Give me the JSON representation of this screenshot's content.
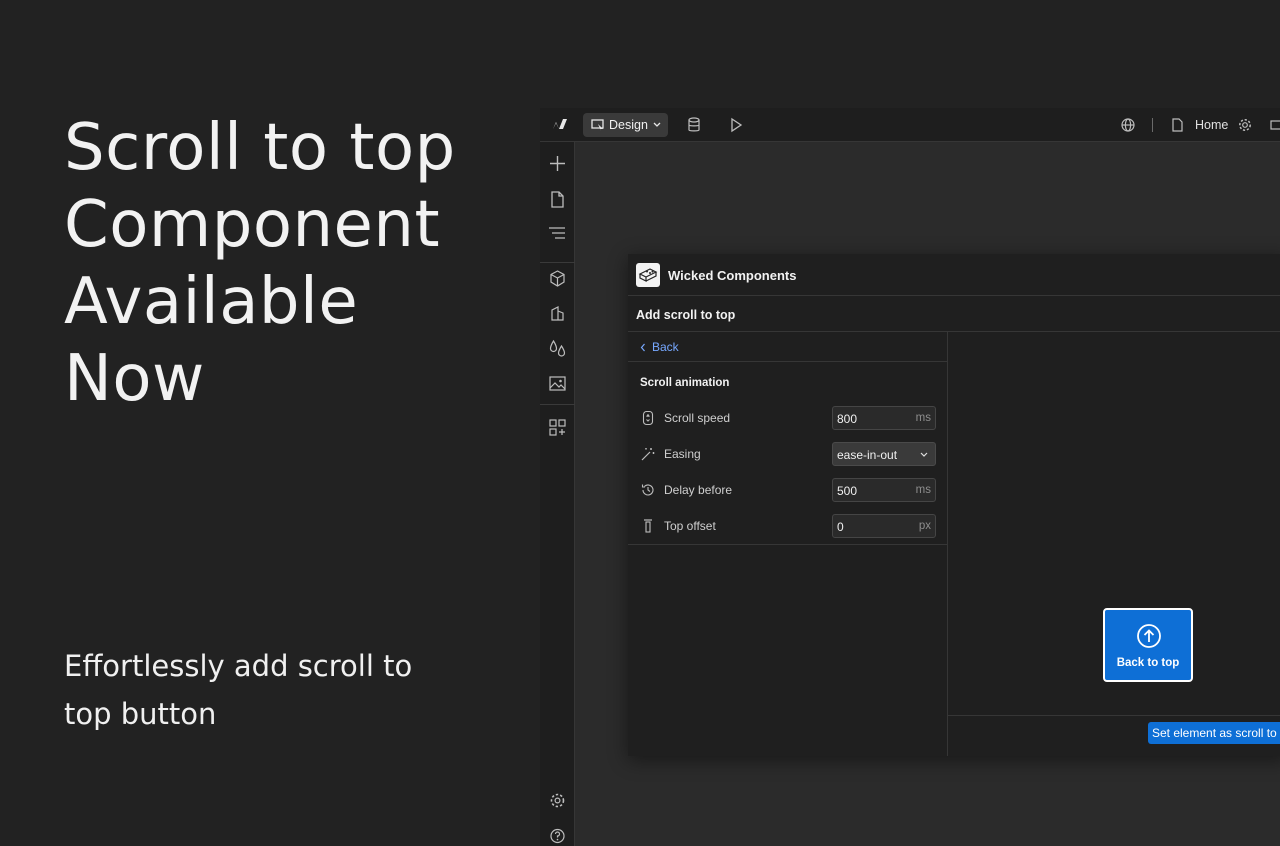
{
  "hero": {
    "lines": [
      "Scroll to top",
      "Component",
      "Available",
      "Now"
    ],
    "subtitle_lines": [
      "Effortlessly add scroll to",
      "top button"
    ]
  },
  "topbar": {
    "mode_label": "Design",
    "page_label": "Home"
  },
  "panel": {
    "app_name": "Wicked Components",
    "title": "Add scroll to top",
    "back_label": "Back",
    "section_title": "Scroll animation",
    "fields": [
      {
        "label": "Scroll speed",
        "value": "800",
        "unit": "ms",
        "icon": "mouse-scroll-icon"
      },
      {
        "label": "Easing",
        "value": "ease-in-out",
        "icon": "magic-wand-icon"
      },
      {
        "label": "Delay before",
        "value": "500",
        "unit": "ms",
        "icon": "history-icon"
      },
      {
        "label": "Top offset",
        "value": "0",
        "unit": "px",
        "icon": "top-offset-icon"
      }
    ],
    "preview_button_label": "Back to top",
    "set_element_label": "Set element as scroll to"
  },
  "colors": {
    "background": "#222222",
    "accent": "#0e6fd6",
    "link": "#77a8ff"
  }
}
